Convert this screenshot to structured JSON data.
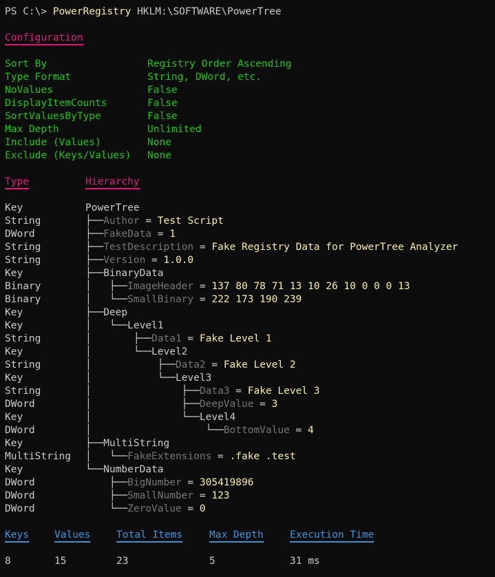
{
  "prompt": {
    "ps": "PS C:\\> ",
    "cmd": "PowerRegistry",
    "arg": " HKLM:\\SOFTWARE\\PowerTree"
  },
  "config": {
    "heading": "Configuration",
    "rows": [
      {
        "key": "Sort By",
        "value": "Registry Order Ascending"
      },
      {
        "key": "Type Format",
        "value": "String, DWord, etc."
      },
      {
        "key": "NoValues",
        "value": "False"
      },
      {
        "key": "DisplayItemCounts",
        "value": "False"
      },
      {
        "key": "SortValuesByType",
        "value": "False"
      },
      {
        "key": "Max Depth",
        "value": "Unlimited"
      },
      {
        "key": "Include (Values)",
        "value": "None"
      },
      {
        "key": "Exclude (Keys/Values)",
        "value": "None"
      }
    ]
  },
  "tree_header": {
    "type": "Type",
    "hierarchy": "Hierarchy"
  },
  "tree": [
    {
      "type": "Key",
      "prefix": "",
      "name": "PowerTree",
      "value": ""
    },
    {
      "type": "String",
      "prefix": "├──",
      "name": "Author",
      "value": "Test Script"
    },
    {
      "type": "DWord",
      "prefix": "├──",
      "name": "FakeData",
      "value": "1"
    },
    {
      "type": "String",
      "prefix": "├──",
      "name": "TestDescription",
      "value": "Fake Registry Data for PowerTree Analyzer"
    },
    {
      "type": "String",
      "prefix": "├──",
      "name": "Version",
      "value": "1.0.0"
    },
    {
      "type": "Key",
      "prefix": "├──",
      "name": "BinaryData",
      "value": ""
    },
    {
      "type": "Binary",
      "prefix": "│   ├──",
      "name": "ImageHeader",
      "value": "137 80 78 71 13 10 26 10 0 0 0 13"
    },
    {
      "type": "Binary",
      "prefix": "│   └──",
      "name": "SmallBinary",
      "value": "222 173 190 239"
    },
    {
      "type": "Key",
      "prefix": "├──",
      "name": "Deep",
      "value": ""
    },
    {
      "type": "Key",
      "prefix": "│   └──",
      "name": "Level1",
      "value": ""
    },
    {
      "type": "String",
      "prefix": "│       ├──",
      "name": "Data1",
      "value": "Fake Level 1"
    },
    {
      "type": "Key",
      "prefix": "│       └──",
      "name": "Level2",
      "value": ""
    },
    {
      "type": "String",
      "prefix": "│           ├──",
      "name": "Data2",
      "value": "Fake Level 2"
    },
    {
      "type": "Key",
      "prefix": "│           └──",
      "name": "Level3",
      "value": ""
    },
    {
      "type": "String",
      "prefix": "│               ├──",
      "name": "Data3",
      "value": "Fake Level 3"
    },
    {
      "type": "DWord",
      "prefix": "│               ├──",
      "name": "DeepValue",
      "value": "3"
    },
    {
      "type": "Key",
      "prefix": "│               └──",
      "name": "Level4",
      "value": ""
    },
    {
      "type": "DWord",
      "prefix": "│                   └──",
      "name": "BottomValue",
      "value": "4"
    },
    {
      "type": "Key",
      "prefix": "├──",
      "name": "MultiString",
      "value": ""
    },
    {
      "type": "MultiString",
      "prefix": "│   └──",
      "name": "FakeExtensions",
      "value": ".fake .test"
    },
    {
      "type": "Key",
      "prefix": "└──",
      "name": "NumberData",
      "value": ""
    },
    {
      "type": "DWord",
      "prefix": "    ├──",
      "name": "BigNumber",
      "value": "305419896"
    },
    {
      "type": "DWord",
      "prefix": "    ├──",
      "name": "SmallNumber",
      "value": "123"
    },
    {
      "type": "DWord",
      "prefix": "    └──",
      "name": "ZeroValue",
      "value": "0"
    }
  ],
  "stats": [
    {
      "label": "Keys",
      "value": "8"
    },
    {
      "label": "Values",
      "value": "15"
    },
    {
      "label": "Total Items",
      "value": "23"
    },
    {
      "label": "Max Depth",
      "value": "5"
    },
    {
      "label": "Execution Time",
      "value": "31 ms"
    }
  ]
}
